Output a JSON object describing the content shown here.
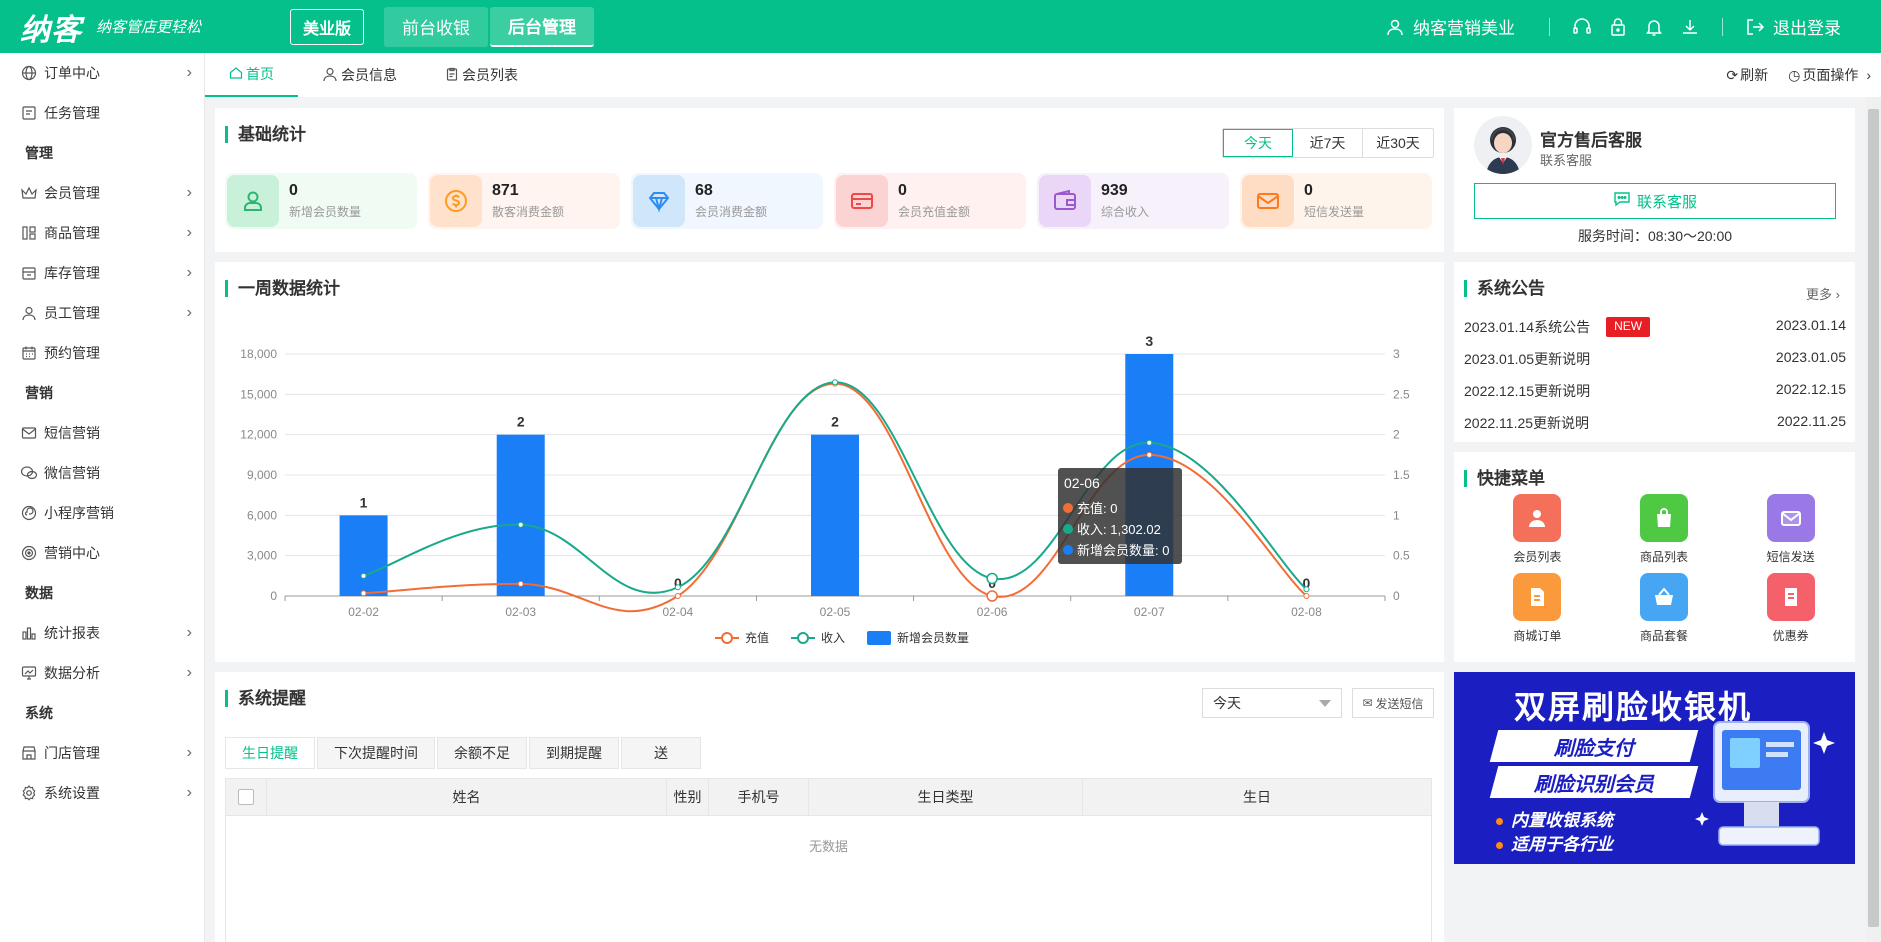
{
  "header": {
    "logo": "纳客",
    "slogan": "纳客管店更轻松",
    "edition": "美业版",
    "tabs": [
      {
        "label": "前台收银",
        "active": false
      },
      {
        "label": "后台管理",
        "active": true
      }
    ],
    "user": "纳客营销美业",
    "logout": "退出登录"
  },
  "sidebar": {
    "items": [
      {
        "type": "item",
        "label": "订单中心",
        "icon": "globe-icon",
        "arrow": true
      },
      {
        "type": "item",
        "label": "任务管理",
        "icon": "task-icon",
        "arrow": false
      },
      {
        "type": "group",
        "label": "管理"
      },
      {
        "type": "item",
        "label": "会员管理",
        "icon": "crown-icon",
        "arrow": true
      },
      {
        "type": "item",
        "label": "商品管理",
        "icon": "goods-icon",
        "arrow": true
      },
      {
        "type": "item",
        "label": "库存管理",
        "icon": "inventory-icon",
        "arrow": true
      },
      {
        "type": "item",
        "label": "员工管理",
        "icon": "user-icon",
        "arrow": true
      },
      {
        "type": "item",
        "label": "预约管理",
        "icon": "calendar-icon",
        "arrow": false
      },
      {
        "type": "group",
        "label": "营销"
      },
      {
        "type": "item",
        "label": "短信营销",
        "icon": "mail-icon",
        "arrow": false
      },
      {
        "type": "item",
        "label": "微信营销",
        "icon": "wechat-icon",
        "arrow": false
      },
      {
        "type": "item",
        "label": "小程序营销",
        "icon": "miniprogram-icon",
        "arrow": false
      },
      {
        "type": "item",
        "label": "营销中心",
        "icon": "target-icon",
        "arrow": false
      },
      {
        "type": "group",
        "label": "数据"
      },
      {
        "type": "item",
        "label": "统计报表",
        "icon": "bar-chart-icon",
        "arrow": true
      },
      {
        "type": "item",
        "label": "数据分析",
        "icon": "monitor-chart-icon",
        "arrow": true
      },
      {
        "type": "group",
        "label": "系统"
      },
      {
        "type": "item",
        "label": "门店管理",
        "icon": "store-icon",
        "arrow": true
      },
      {
        "type": "item",
        "label": "系统设置",
        "icon": "gear-icon",
        "arrow": true
      }
    ]
  },
  "pagetabs": {
    "tabs": [
      {
        "label": "首页",
        "icon": "home-icon",
        "active": true
      },
      {
        "label": "会员信息",
        "icon": "user-icon",
        "active": false
      },
      {
        "label": "会员列表",
        "icon": "clipboard-icon",
        "active": false
      }
    ],
    "refresh": "刷新",
    "page_ops": "页面操作"
  },
  "basic_stats": {
    "title": "基础统计",
    "ranges": [
      {
        "label": "今天",
        "active": true
      },
      {
        "label": "近7天",
        "active": false
      },
      {
        "label": "近30天",
        "active": false
      }
    ],
    "items": [
      {
        "value": "0",
        "label": "新增会员数量",
        "icon": "person-icon",
        "bg": "#f0fbf4",
        "icon_bg": "#c9f0d8",
        "color": "#2bb673"
      },
      {
        "value": "871",
        "label": "散客消费金额",
        "icon": "coin-icon",
        "bg": "#fff4f0",
        "icon_bg": "#ffe1cc",
        "color": "#ff9a1e"
      },
      {
        "value": "68",
        "label": "会员消费金额",
        "icon": "diamond-icon",
        "bg": "#f0f7fe",
        "icon_bg": "#cfe6fb",
        "color": "#2d8cf0"
      },
      {
        "value": "0",
        "label": "会员充值金额",
        "icon": "card-icon",
        "bg": "#fff1f0",
        "icon_bg": "#fcd3d3",
        "color": "#f04848"
      },
      {
        "value": "939",
        "label": "综合收入",
        "icon": "wallet-icon",
        "bg": "#f7f1fc",
        "icon_bg": "#ead7f7",
        "color": "#9b59d0"
      },
      {
        "value": "0",
        "label": "短信发送量",
        "icon": "mail-icon",
        "bg": "#fff4ec",
        "icon_bg": "#ffdcc4",
        "color": "#ff7a1e"
      }
    ]
  },
  "weekly": {
    "title": "一周数据统计",
    "tooltip": {
      "title": "02-06",
      "lines": [
        "充值: 0",
        "收入: 1,302.02",
        "新增会员数量: 0"
      ]
    }
  },
  "chart_data": {
    "type": "bar",
    "categories": [
      "02-02",
      "02-03",
      "02-04",
      "02-05",
      "02-06",
      "02-07",
      "02-08"
    ],
    "series": [
      {
        "name": "充值",
        "type": "line",
        "axis": "left",
        "color": "#f36c36",
        "values": [
          200,
          900,
          0,
          15800,
          0,
          10500,
          0
        ]
      },
      {
        "name": "收入",
        "type": "line",
        "axis": "left",
        "color": "#18a98a",
        "values": [
          1500,
          5300,
          650,
          15900,
          1302.02,
          11400,
          500
        ]
      },
      {
        "name": "新增会员数量",
        "type": "bar",
        "axis": "right",
        "color": "#1a7ff7",
        "values": [
          1,
          2,
          0,
          2,
          0,
          3,
          0
        ]
      }
    ],
    "y_left": {
      "min": 0,
      "max": 18000,
      "ticks": [
        "0",
        "3,000",
        "6,000",
        "9,000",
        "12,000",
        "15,000",
        "18,000"
      ]
    },
    "y_right": {
      "min": 0,
      "max": 3,
      "ticks": [
        "0",
        "0.5",
        "1",
        "1.5",
        "2",
        "2.5",
        "3"
      ]
    },
    "grid": true,
    "legend": "bottom"
  },
  "reminder": {
    "title": "系统提醒",
    "select_value": "今天",
    "sms_button": "发送短信",
    "tabs": [
      {
        "label": "生日提醒",
        "active": true
      },
      {
        "label": "下次提醒时间",
        "active": false
      },
      {
        "label": "余额不足",
        "active": false
      },
      {
        "label": "到期提醒",
        "active": false
      },
      {
        "label": "送",
        "active": false
      }
    ],
    "columns": [
      "姓名",
      "性别",
      "手机号",
      "生日类型",
      "生日"
    ],
    "empty": "无数据"
  },
  "customer_service": {
    "title": "官方售后客服",
    "subtitle": "联系客服",
    "button": "联系客服",
    "hours": "服务时间：08:30～20:00"
  },
  "notices": {
    "title": "系统公告",
    "more": "更多 ›",
    "new_badge": "NEW",
    "items": [
      {
        "title": "2023.01.14系统公告",
        "date": "2023.01.14",
        "is_new": true
      },
      {
        "title": "2023.01.05更新说明",
        "date": "2023.01.05",
        "is_new": false
      },
      {
        "title": "2022.12.15更新说明",
        "date": "2022.12.15",
        "is_new": false
      },
      {
        "title": "2022.11.25更新说明",
        "date": "2022.11.25",
        "is_new": false
      }
    ]
  },
  "quick_menu": {
    "title": "快捷菜单",
    "items": [
      {
        "label": "会员列表",
        "icon": "member-list-icon",
        "color": "#f5705a"
      },
      {
        "label": "商品列表",
        "icon": "shopping-bag-icon",
        "color": "#4fc943"
      },
      {
        "label": "短信发送",
        "icon": "sms-icon",
        "color": "#9a78e6"
      },
      {
        "label": "商城订单",
        "icon": "order-icon",
        "color": "#fb9a3c"
      },
      {
        "label": "商品套餐",
        "icon": "basket-icon",
        "color": "#47a6f3"
      },
      {
        "label": "优惠券",
        "icon": "coupon-icon",
        "color": "#f4616b"
      }
    ]
  },
  "banner": {
    "title": "双屏刷脸收银机",
    "tags": [
      "刷脸支付",
      "刷脸识别会员"
    ],
    "lines": [
      "内置收银系统",
      "适用于各行业"
    ]
  }
}
